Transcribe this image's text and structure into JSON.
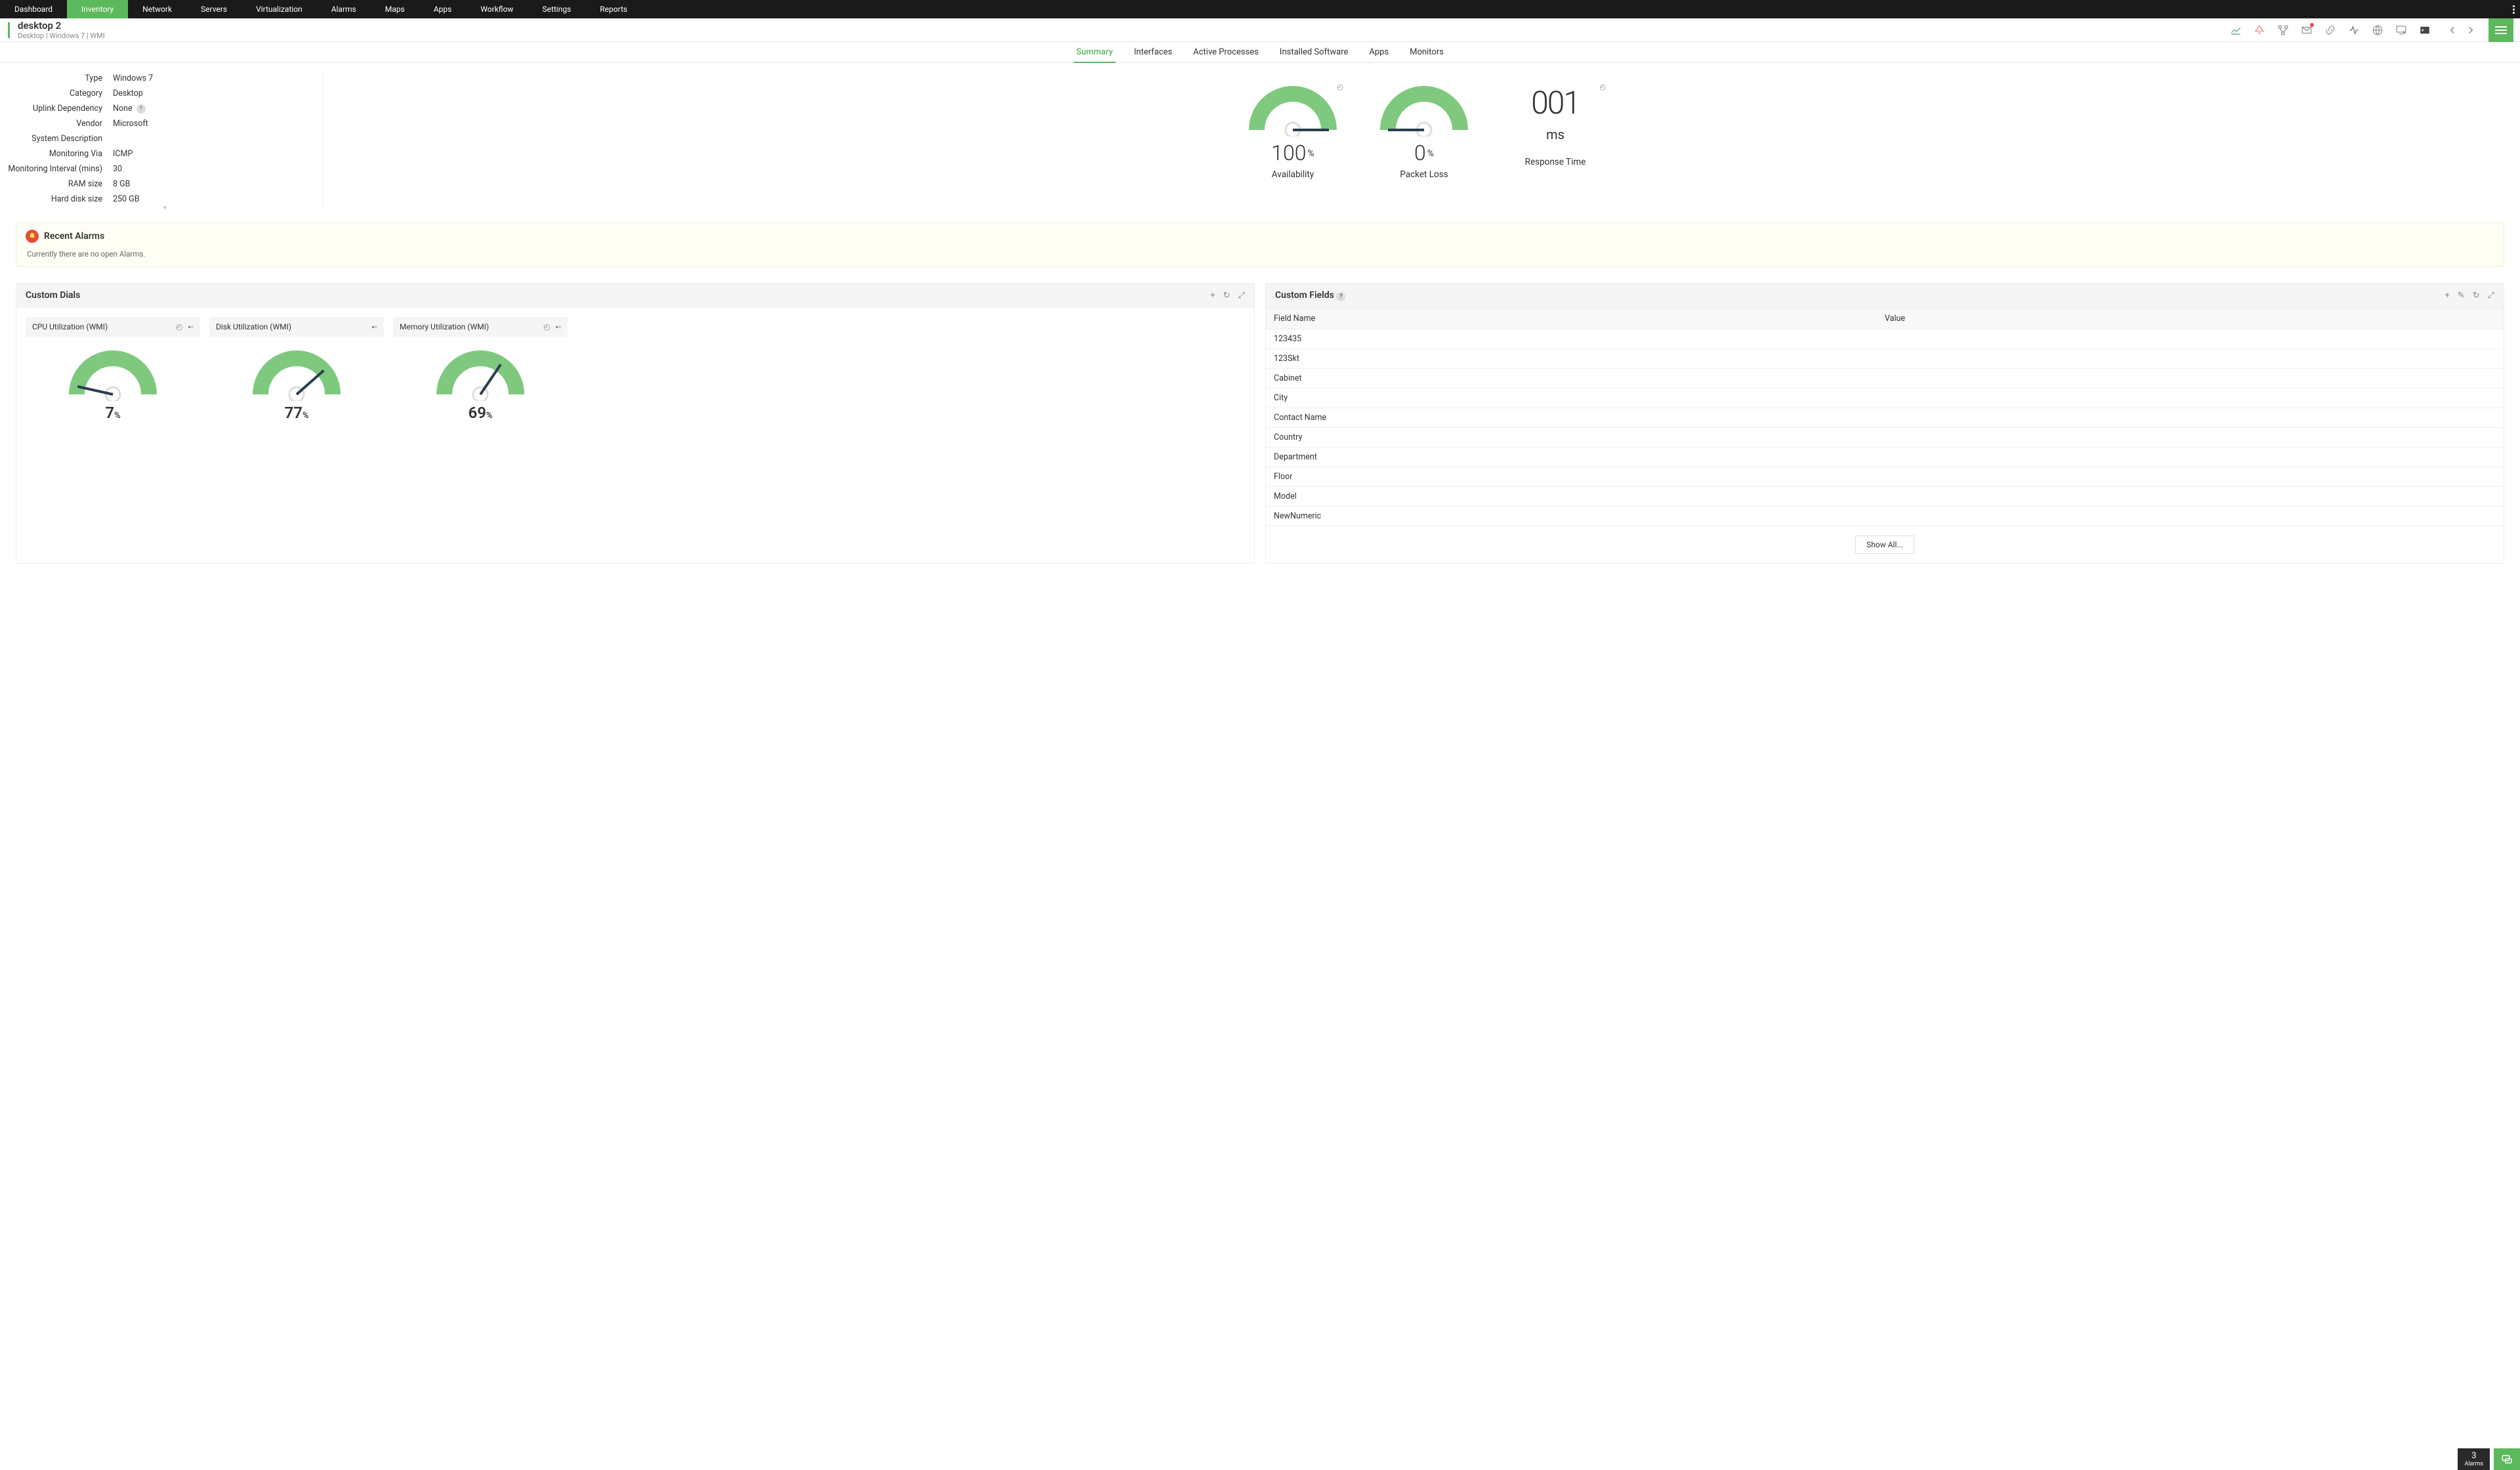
{
  "topnav": {
    "items": [
      "Dashboard",
      "Inventory",
      "Network",
      "Servers",
      "Virtualization",
      "Alarms",
      "Maps",
      "Apps",
      "Workflow",
      "Settings",
      "Reports"
    ],
    "active_index": 1
  },
  "device": {
    "title": "desktop 2",
    "crumbs": "Desktop  |  Windows 7  |  WMI"
  },
  "tabs": {
    "items": [
      "Summary",
      "Interfaces",
      "Active Processes",
      "Installed Software",
      "Apps",
      "Monitors"
    ],
    "active_index": 0
  },
  "info": {
    "rows": [
      {
        "label": "Type",
        "value": "Windows 7"
      },
      {
        "label": "Category",
        "value": "Desktop"
      },
      {
        "label": "Uplink Dependency",
        "value": "None",
        "help": true
      },
      {
        "label": "Vendor",
        "value": "Microsoft"
      },
      {
        "label": "System Description",
        "value": ""
      },
      {
        "label": "Monitoring Via",
        "value": "ICMP"
      },
      {
        "label": "Monitoring Interval (mins)",
        "value": "30"
      },
      {
        "label": "RAM size",
        "value": "8 GB"
      },
      {
        "label": "Hard disk size",
        "value": "250 GB"
      }
    ]
  },
  "gauges": {
    "availability": {
      "value": "100",
      "unit": "%",
      "label": "Availability"
    },
    "packet_loss": {
      "value": "0",
      "unit": "%",
      "label": "Packet Loss"
    },
    "response_time": {
      "value": "001",
      "unit": "ms",
      "label": "Response Time"
    }
  },
  "alarms": {
    "title": "Recent Alarms",
    "message": "Currently there are no open Alarms."
  },
  "custom_dials": {
    "title": "Custom Dials",
    "dials": [
      {
        "title": "CPU Utilization (WMI)",
        "value": "7",
        "icons": 2
      },
      {
        "title": "Disk Utilization (WMI)",
        "value": "77",
        "icons": 1
      },
      {
        "title": "Memory Utilization (WMI)",
        "value": "69",
        "icons": 2
      }
    ]
  },
  "custom_fields": {
    "title": "Custom Fields",
    "head": {
      "col1": "Field Name",
      "col2": "Value"
    },
    "rows": [
      {
        "name": "123435",
        "value": ""
      },
      {
        "name": "123Skt",
        "value": ""
      },
      {
        "name": "Cabinet",
        "value": ""
      },
      {
        "name": "City",
        "value": ""
      },
      {
        "name": "Contact Name",
        "value": ""
      },
      {
        "name": "Country",
        "value": ""
      },
      {
        "name": "Department",
        "value": ""
      },
      {
        "name": "Floor",
        "value": ""
      },
      {
        "name": "Model",
        "value": ""
      },
      {
        "name": "NewNumeric",
        "value": ""
      }
    ],
    "showall": "Show All..."
  },
  "footer": {
    "alarm_count": "3",
    "alarm_label": "Alarms"
  },
  "chart_data": [
    {
      "type": "gauge",
      "title": "Availability",
      "value": 100,
      "unit": "%",
      "range": [
        0,
        100
      ]
    },
    {
      "type": "gauge",
      "title": "Packet Loss",
      "value": 0,
      "unit": "%",
      "range": [
        0,
        100
      ]
    },
    {
      "type": "gauge",
      "title": "CPU Utilization (WMI)",
      "value": 7,
      "unit": "%",
      "range": [
        0,
        100
      ]
    },
    {
      "type": "gauge",
      "title": "Disk Utilization (WMI)",
      "value": 77,
      "unit": "%",
      "range": [
        0,
        100
      ]
    },
    {
      "type": "gauge",
      "title": "Memory Utilization (WMI)",
      "value": 69,
      "unit": "%",
      "range": [
        0,
        100
      ]
    }
  ]
}
